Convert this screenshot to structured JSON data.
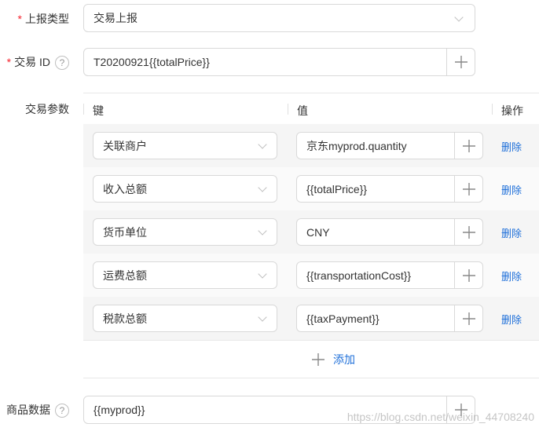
{
  "report_type": {
    "label": "上报类型",
    "required": "*",
    "value": "交易上报"
  },
  "tx_id": {
    "label": "交易 ID",
    "required": "*",
    "help": "?",
    "value": "T20200921{{totalPrice}}"
  },
  "params": {
    "label": "交易参数",
    "col_key": "键",
    "col_value": "值",
    "col_action": "操作",
    "rows": [
      {
        "key": "关联商户",
        "value": "京东myprod.quantity",
        "delete": "删除"
      },
      {
        "key": "收入总额",
        "value": "{{totalPrice}}",
        "delete": "删除"
      },
      {
        "key": "货币单位",
        "value": "CNY",
        "delete": "删除"
      },
      {
        "key": "运费总额",
        "value": "{{transportationCost}}",
        "delete": "删除"
      },
      {
        "key": "税款总额",
        "value": "{{taxPayment}}",
        "delete": "删除"
      }
    ],
    "add_label": "添加"
  },
  "product_data": {
    "label": "商品数据",
    "help": "?",
    "value": "{{myprod}}"
  },
  "watermark": "https://blog.csdn.net/weixin_44708240",
  "colors": {
    "accent": "#1e6fd9",
    "required": "#f5222d",
    "border": "#d9d9d9"
  }
}
